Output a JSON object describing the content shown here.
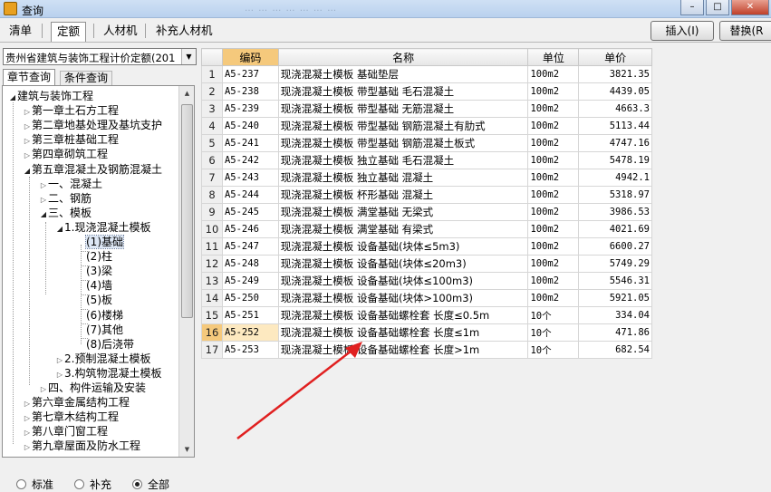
{
  "window": {
    "title": "查询",
    "ghost_title": "… … … … … … …",
    "buttons": [
      "–",
      "□",
      "✕"
    ]
  },
  "top_tabs": [
    {
      "label": "清单",
      "active": false
    },
    {
      "label": "定额",
      "active": true
    },
    {
      "label": "人材机",
      "active": false
    },
    {
      "label": "补充人材机",
      "active": false
    }
  ],
  "actions": {
    "insert": "插入(I)",
    "replace": "替换(R"
  },
  "left": {
    "quota_library": "贵州省建筑与装饰工程计价定额(201",
    "subtabs": [
      "章节查询",
      "条件查询"
    ],
    "tree": [
      {
        "label": "建筑与装饰工程",
        "level": 0,
        "toggle": "open"
      },
      {
        "label": "第一章土石方工程",
        "level": 1,
        "toggle": "closed"
      },
      {
        "label": "第二章地基处理及基坑支护",
        "level": 1,
        "toggle": "closed"
      },
      {
        "label": "第三章桩基础工程",
        "level": 1,
        "toggle": "closed"
      },
      {
        "label": "第四章砌筑工程",
        "level": 1,
        "toggle": "closed"
      },
      {
        "label": "第五章混凝土及钢筋混凝土",
        "level": 1,
        "toggle": "open"
      },
      {
        "label": "一、混凝土",
        "level": 2,
        "toggle": "closed"
      },
      {
        "label": "二、钢筋",
        "level": 2,
        "toggle": "closed"
      },
      {
        "label": "三、模板",
        "level": 2,
        "toggle": "open"
      },
      {
        "label": "1.现浇混凝土模板",
        "level": 3,
        "toggle": "open"
      },
      {
        "label": "(1)基础",
        "level": 4,
        "toggle": "none",
        "selected": true
      },
      {
        "label": "(2)柱",
        "level": 4,
        "toggle": "none"
      },
      {
        "label": "(3)梁",
        "level": 4,
        "toggle": "none"
      },
      {
        "label": "(4)墙",
        "level": 4,
        "toggle": "none"
      },
      {
        "label": "(5)板",
        "level": 4,
        "toggle": "none"
      },
      {
        "label": "(6)楼梯",
        "level": 4,
        "toggle": "none"
      },
      {
        "label": "(7)其他",
        "level": 4,
        "toggle": "none"
      },
      {
        "label": "(8)后浇带",
        "level": 4,
        "toggle": "none"
      },
      {
        "label": "2.预制混凝土模板",
        "level": 3,
        "toggle": "closed"
      },
      {
        "label": "3.构筑物混凝土模板",
        "level": 3,
        "toggle": "closed"
      },
      {
        "label": "四、构件运输及安装",
        "level": 2,
        "toggle": "closed"
      },
      {
        "label": "第六章金属结构工程",
        "level": 1,
        "toggle": "closed"
      },
      {
        "label": "第七章木结构工程",
        "level": 1,
        "toggle": "closed"
      },
      {
        "label": "第八章门窗工程",
        "level": 1,
        "toggle": "closed"
      },
      {
        "label": "第九章屋面及防水工程",
        "level": 1,
        "toggle": "closed"
      }
    ],
    "filter": {
      "options": [
        "标准",
        "补充",
        "全部"
      ],
      "selected": "全部"
    }
  },
  "table": {
    "headers": [
      "",
      "编码",
      "名称",
      "单位",
      "单价"
    ],
    "current_row": 16,
    "rows": [
      [
        "1",
        "A5-237",
        "现浇混凝土模板 基础垫层",
        "100m2",
        "3821.35"
      ],
      [
        "2",
        "A5-238",
        "现浇混凝土模板 带型基础 毛石混凝土",
        "100m2",
        "4439.05"
      ],
      [
        "3",
        "A5-239",
        "现浇混凝土模板 带型基础 无筋混凝土",
        "100m2",
        "4663.3"
      ],
      [
        "4",
        "A5-240",
        "现浇混凝土模板 带型基础 钢筋混凝土有肋式",
        "100m2",
        "5113.44"
      ],
      [
        "5",
        "A5-241",
        "现浇混凝土模板 带型基础 钢筋混凝土板式",
        "100m2",
        "4747.16"
      ],
      [
        "6",
        "A5-242",
        "现浇混凝土模板 独立基础 毛石混凝土",
        "100m2",
        "5478.19"
      ],
      [
        "7",
        "A5-243",
        "现浇混凝土模板 独立基础 混凝土",
        "100m2",
        "4942.1"
      ],
      [
        "8",
        "A5-244",
        "现浇混凝土模板 杯形基础 混凝土",
        "100m2",
        "5318.97"
      ],
      [
        "9",
        "A5-245",
        "现浇混凝土模板 满堂基础 无梁式",
        "100m2",
        "3986.53"
      ],
      [
        "10",
        "A5-246",
        "现浇混凝土模板 满堂基础 有梁式",
        "100m2",
        "4021.69"
      ],
      [
        "11",
        "A5-247",
        "现浇混凝土模板 设备基础(块体≤5m3)",
        "100m2",
        "6600.27"
      ],
      [
        "12",
        "A5-248",
        "现浇混凝土模板 设备基础(块体≤20m3)",
        "100m2",
        "5749.29"
      ],
      [
        "13",
        "A5-249",
        "现浇混凝土模板 设备基础(块体≤100m3)",
        "100m2",
        "5546.31"
      ],
      [
        "14",
        "A5-250",
        "现浇混凝土模板 设备基础(块体>100m3)",
        "100m2",
        "5921.05"
      ],
      [
        "15",
        "A5-251",
        "现浇混凝土模板 设备基础螺栓套 长度≤0.5m",
        "10个",
        "334.04"
      ],
      [
        "16",
        "A5-252",
        "现浇混凝土模板 设备基础螺栓套 长度≤1m",
        "10个",
        "471.86"
      ],
      [
        "17",
        "A5-253",
        "现浇混凝土模板 设备基础螺栓套 长度>1m",
        "10个",
        "682.54"
      ]
    ]
  },
  "colors": {
    "header_accent": "#f5c97c",
    "annotation_arrow": "#e02020"
  }
}
